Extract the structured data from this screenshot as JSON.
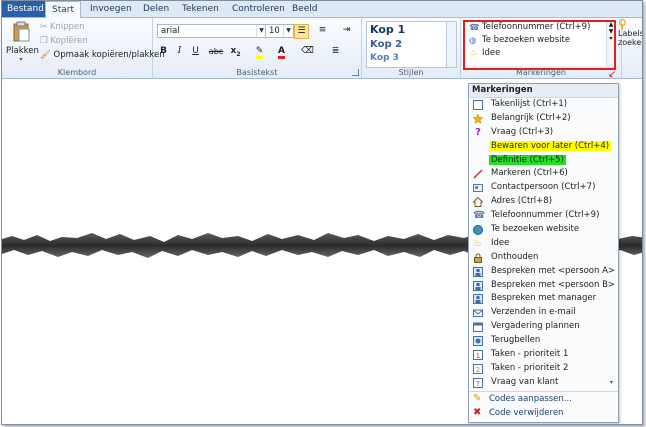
{
  "tabs": [
    "Bestand",
    "Start",
    "Invoegen",
    "Delen",
    "Tekenen",
    "Controleren",
    "Beeld"
  ],
  "clipboard": {
    "paste": "Plakken",
    "cut": "Knippen",
    "copy": "Kopiëren",
    "format_painter": "Opmaak kopiëren/plakken",
    "group": "Klembord"
  },
  "basic_text": {
    "font": "arial",
    "size": "10",
    "bold": "B",
    "italic": "I",
    "underline": "U",
    "strike": "abc",
    "subscript": "x",
    "group": "Basistekst"
  },
  "styles": {
    "items": [
      "Kop 1",
      "Kop 2",
      "Kop 3"
    ],
    "group": "Stijlen"
  },
  "tags": {
    "visible": [
      "Telefoonnummer (Ctrl+9)",
      "Te bezoeken website",
      "Idee"
    ],
    "group": "Markeringen",
    "labels_button": "Labels zoeken"
  },
  "menu": {
    "header": "Markeringen",
    "items": [
      {
        "label": "Takenlijst (Ctrl+1)",
        "icon": "checkbox-icon"
      },
      {
        "label": "Belangrijk (Ctrl+2)",
        "icon": "star-icon"
      },
      {
        "label": "Vraag (Ctrl+3)",
        "icon": "question-icon"
      },
      {
        "label": "Bewaren voor later (Ctrl+4)",
        "icon": "highlight-yellow",
        "highlight": "#ffff00"
      },
      {
        "label": "Definitie (Ctrl+5)",
        "icon": "highlight-green",
        "highlight": "#22e022"
      },
      {
        "label": "Markeren (Ctrl+6)",
        "icon": "pen-icon"
      },
      {
        "label": "Contactpersoon (Ctrl+7)",
        "icon": "contact-icon"
      },
      {
        "label": "Adres (Ctrl+8)",
        "icon": "house-icon"
      },
      {
        "label": "Telefoonnummer (Ctrl+9)",
        "icon": "phone-icon"
      },
      {
        "label": "Te bezoeken website",
        "icon": "globe-icon"
      },
      {
        "label": "Idee",
        "icon": "bulb-icon"
      },
      {
        "label": "Onthouden",
        "icon": "lock-icon"
      },
      {
        "label": "Bespreken met <persoon A>",
        "icon": "person-a-icon"
      },
      {
        "label": "Bespreken met <persoon B>",
        "icon": "person-b-icon"
      },
      {
        "label": "Bespreken met manager",
        "icon": "manager-icon"
      },
      {
        "label": "Verzenden in e-mail",
        "icon": "email-icon"
      },
      {
        "label": "Vergadering plannen",
        "icon": "meeting-icon"
      },
      {
        "label": "Terugbellen",
        "icon": "callback-icon"
      },
      {
        "label": "Taken - prioriteit 1",
        "icon": "priority-1-icon"
      },
      {
        "label": "Taken - prioriteit 2",
        "icon": "priority-2-icon"
      },
      {
        "label": "Vraag van klant",
        "icon": "client-question-icon"
      }
    ],
    "customize": "Codes aanpassen...",
    "remove": "Code verwijderen"
  }
}
